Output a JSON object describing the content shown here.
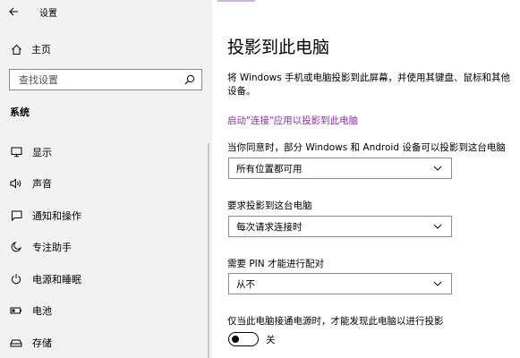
{
  "window": {
    "title": "设置"
  },
  "sidebar": {
    "home_label": "主页",
    "search_placeholder": "查找设置",
    "section_title": "系统",
    "items": [
      {
        "label": "显示",
        "icon": "monitor-icon"
      },
      {
        "label": "声音",
        "icon": "speaker-icon"
      },
      {
        "label": "通知和操作",
        "icon": "notification-icon"
      },
      {
        "label": "专注助手",
        "icon": "moon-icon"
      },
      {
        "label": "电源和睡眠",
        "icon": "power-icon"
      },
      {
        "label": "电池",
        "icon": "battery-icon"
      },
      {
        "label": "存储",
        "icon": "storage-icon"
      }
    ]
  },
  "main": {
    "title": "投影到此电脑",
    "description": "将 Windows 手机或电脑投影到此屏幕，并使用其键盘、鼠标和其他设备。",
    "link": "启动\"连接\"应用以投影到此电脑",
    "setting1_label": "当你同意时，部分 Windows 和 Android 设备可以投影到这台电脑",
    "setting1_value": "所有位置都可用",
    "setting2_label": "要求投影到这台电脑",
    "setting2_value": "每次请求连接时",
    "setting3_label": "需要 PIN 才能进行配对",
    "setting3_value": "从不",
    "setting4_label": "仅当此电脑接通电源时，才能发现此电脑以进行投影",
    "toggle_label": "关"
  },
  "colors": {
    "link": "#8b2fa8",
    "sidebar_bg": "#f2f2f2"
  }
}
